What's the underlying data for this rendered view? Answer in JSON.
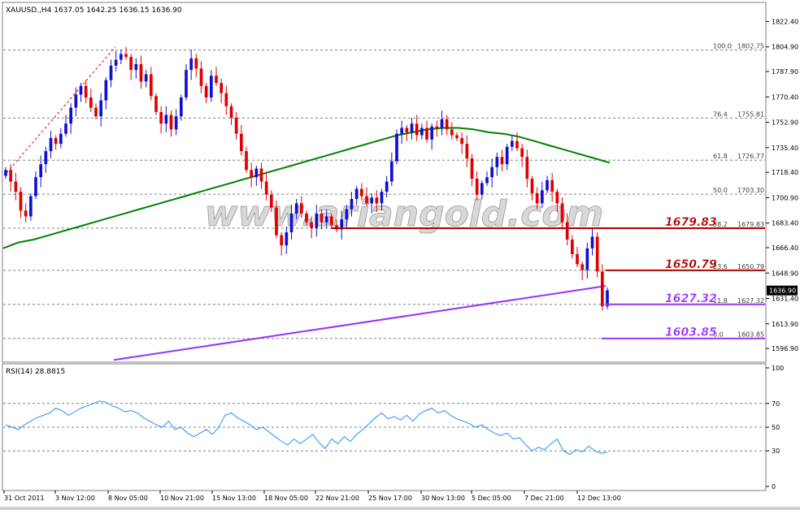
{
  "chart_data": [
    {
      "type": "candlestick",
      "header": "XAUUSD.,H4  1637.05 1642.25 1636.15 1636.90",
      "watermark": "www.ariangold.com",
      "ylim": [
        1588.0,
        1835.0
      ],
      "y_ticks": [
        "1822.40",
        "1804.90",
        "1787.90",
        "1770.40",
        "1752.90",
        "1735.40",
        "1718.40",
        "1700.90",
        "1683.40",
        "1666.40",
        "1648.90",
        "1631.40",
        "1613.90",
        "1596.90"
      ],
      "price_box": "1636.90",
      "fib_levels": [
        {
          "ratio": "100.0",
          "value": "1802.75",
          "price": 1802.75
        },
        {
          "ratio": "76.4",
          "value": "1755.81",
          "price": 1755.81
        },
        {
          "ratio": "61.8",
          "value": "1726.77",
          "price": 1726.77
        },
        {
          "ratio": "50.0",
          "value": "1703.30",
          "price": 1703.3
        },
        {
          "ratio": "38.2",
          "value": "1679.83",
          "price": 1679.83
        },
        {
          "ratio": "23.6",
          "value": "1650.79",
          "price": 1650.79
        },
        {
          "ratio": "11.8",
          "value": "1627.32",
          "price": 1627.32
        },
        {
          "ratio": "0.0",
          "value": "1603.85",
          "price": 1603.85
        }
      ],
      "level_labels": [
        {
          "text": "1679.83",
          "price": 1679.83,
          "color": "#b00000"
        },
        {
          "text": "1650.79",
          "price": 1650.79,
          "color": "#b00000"
        },
        {
          "text": "1627.32",
          "price": 1627.32,
          "color": "#9b30ff"
        },
        {
          "text": "1603.85",
          "price": 1603.85,
          "color": "#9b30ff"
        }
      ],
      "x_ticks": [
        "31 Oct 2011",
        "3 Nov 12:00",
        "8 Nov 05:00",
        "10 Nov 21:00",
        "15 Nov 13:00",
        "18 Nov 05:00",
        "22 Nov 21:00",
        "25 Nov 17:00",
        "30 Nov 13:00",
        "5 Dec 05:00",
        "7 Dec 21:00",
        "12 Dec 13:00"
      ],
      "colors": {
        "bull": "#1010d0",
        "bear": "#e00000",
        "ma": "#008000",
        "long_ma": "#9b30ff",
        "grid": "#808080"
      },
      "closes": [
        1720,
        1712,
        1705,
        1692,
        1688,
        1702,
        1715,
        1724,
        1733,
        1742,
        1738,
        1745,
        1752,
        1763,
        1772,
        1778,
        1770,
        1763,
        1757,
        1768,
        1782,
        1792,
        1796,
        1800,
        1798,
        1789,
        1793,
        1781,
        1786,
        1771,
        1760,
        1752,
        1758,
        1748,
        1757,
        1770,
        1789,
        1797,
        1790,
        1778,
        1770,
        1785,
        1780,
        1773,
        1764,
        1756,
        1745,
        1733,
        1720,
        1715,
        1721,
        1712,
        1703,
        1694,
        1675,
        1668,
        1677,
        1690,
        1697,
        1690,
        1684,
        1680,
        1690,
        1684,
        1688,
        1682,
        1679,
        1686,
        1693,
        1700,
        1707,
        1702,
        1697,
        1701,
        1697,
        1705,
        1712,
        1726,
        1745,
        1749,
        1746,
        1752,
        1744,
        1749,
        1741,
        1750,
        1749,
        1755,
        1748,
        1744,
        1742,
        1738,
        1728,
        1714,
        1703,
        1711,
        1715,
        1722,
        1729,
        1724,
        1736,
        1740,
        1735,
        1729,
        1714,
        1704,
        1697,
        1706,
        1713,
        1705,
        1697,
        1684,
        1672,
        1662,
        1655,
        1651,
        1666,
        1674,
        1650,
        1626,
        1637
      ],
      "ma_values": [
        1666,
        1670,
        1672,
        1675,
        1678,
        1681,
        1684,
        1687,
        1690,
        1693,
        1696,
        1699,
        1702,
        1705,
        1708,
        1711,
        1714,
        1717,
        1720,
        1723,
        1726,
        1729,
        1732,
        1735,
        1738,
        1741,
        1744,
        1746,
        1748,
        1749,
        1749,
        1748,
        1746,
        1745,
        1743,
        1740,
        1737,
        1734,
        1731,
        1728,
        1725
      ],
      "long_ma": {
        "start": 1589,
        "end": 1640
      },
      "rsi": {
        "label": "RSI(14) 28.8815",
        "ylim": [
          0,
          100
        ],
        "ticks": [
          "100",
          "70",
          "50",
          "30",
          "0"
        ],
        "levels": [
          70,
          50,
          30
        ],
        "values": [
          52,
          50,
          48,
          52,
          55,
          58,
          60,
          62,
          66,
          64,
          60,
          63,
          66,
          68,
          70,
          72,
          71,
          68,
          66,
          63,
          64,
          62,
          58,
          55,
          52,
          50,
          55,
          48,
          50,
          45,
          42,
          45,
          48,
          44,
          50,
          60,
          62,
          58,
          55,
          52,
          48,
          50,
          46,
          42,
          38,
          35,
          40,
          36,
          40,
          44,
          37,
          32,
          40,
          36,
          42,
          38,
          44,
          48,
          53,
          58,
          62,
          57,
          59,
          56,
          60,
          55,
          61,
          64,
          66,
          62,
          64,
          60,
          57,
          55,
          53,
          50,
          52,
          48,
          45,
          43,
          45,
          40,
          41,
          35,
          30,
          33,
          31,
          36,
          40,
          30,
          27,
          31,
          29,
          34,
          30,
          28,
          29
        ]
      }
    }
  ]
}
